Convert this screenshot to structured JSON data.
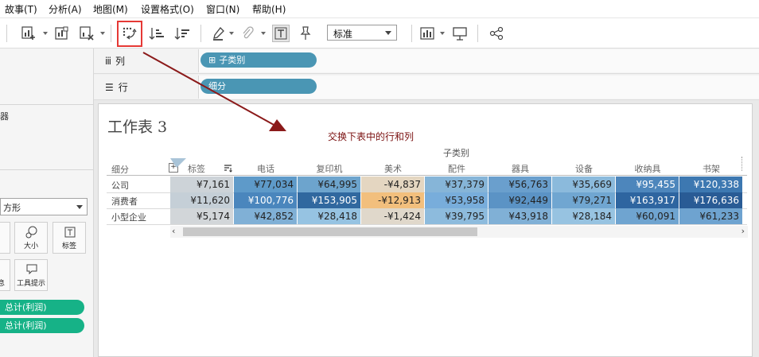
{
  "menu": {
    "items": [
      "故事(T)",
      "分析(A)",
      "地图(M)",
      "设置格式(O)",
      "窗口(N)",
      "帮助(H)"
    ]
  },
  "toolbar": {
    "icons": [
      "new-worksheet-icon",
      "new-dashboard-icon",
      "clear-sheet-icon",
      "swap-rows-columns-icon",
      "sort-ascending-icon",
      "sort-descending-icon",
      "highlight-pen-icon",
      "paperclip-icon",
      "text-label-icon",
      "pin-icon",
      "show-me-icon",
      "presentation-icon",
      "share-icon"
    ],
    "fit_select": "标准"
  },
  "left_panel": {
    "filters_fragment": "器",
    "mark_type": "方形",
    "marks_buttons": [
      "大小",
      "标签",
      "息",
      "工具提示"
    ],
    "green_pills": [
      "总计(利润)",
      "总计(利润)"
    ]
  },
  "shelves": {
    "columns_label": "列",
    "columns_pill": "子类别",
    "rows_label": "行",
    "rows_pill": "细分"
  },
  "sheet": {
    "title": "工作表 3",
    "annotation": "交换下表中的行和列",
    "column_group_title": "子类别",
    "row_header_title": "细分",
    "columns": [
      "标签",
      "电话",
      "复印机",
      "美术",
      "配件",
      "器具",
      "设备",
      "收纳具",
      "书架"
    ],
    "rows": [
      {
        "name": "公司",
        "cells": [
          "¥7,161",
          "¥77,034",
          "¥64,995",
          "-¥4,837",
          "¥37,379",
          "¥56,763",
          "¥35,669",
          "¥95,455",
          "¥120,338"
        ]
      },
      {
        "name": "消费者",
        "cells": [
          "¥11,620",
          "¥100,776",
          "¥153,905",
          "-¥12,913",
          "¥53,958",
          "¥92,449",
          "¥79,271",
          "¥163,917",
          "¥176,636"
        ]
      },
      {
        "name": "小型企业",
        "cells": [
          "¥5,174",
          "¥42,852",
          "¥28,418",
          "-¥1,424",
          "¥39,795",
          "¥43,918",
          "¥28,184",
          "¥60,091",
          "¥61,233"
        ]
      }
    ],
    "cell_colors": [
      [
        "#cdd3d8",
        "#5e9ac9",
        "#6da4cd",
        "#e4d6c1",
        "#86b5d8",
        "#6a9fcd",
        "#8bbadc",
        "#4d86bc",
        "#3d78b1"
      ],
      [
        "#c5cfd7",
        "#4a86bd",
        "#30689f",
        "#f2bf7d",
        "#78addb",
        "#5b93c5",
        "#70a6d1",
        "#2e65a0",
        "#295b95"
      ],
      [
        "#d2d6d9",
        "#80b0d6",
        "#96c3e2",
        "#e0d8cb",
        "#8dbbdd",
        "#80b0d6",
        "#97c3e1",
        "#6fa4d0",
        "#6ea3d0"
      ]
    ],
    "dark_text_threshold_note": ""
  },
  "colors": {
    "pill_blue": "#4a96b4",
    "pill_green": "#16b287",
    "highlight_red": "#e53935",
    "arrow_red": "#8b1a1a"
  }
}
